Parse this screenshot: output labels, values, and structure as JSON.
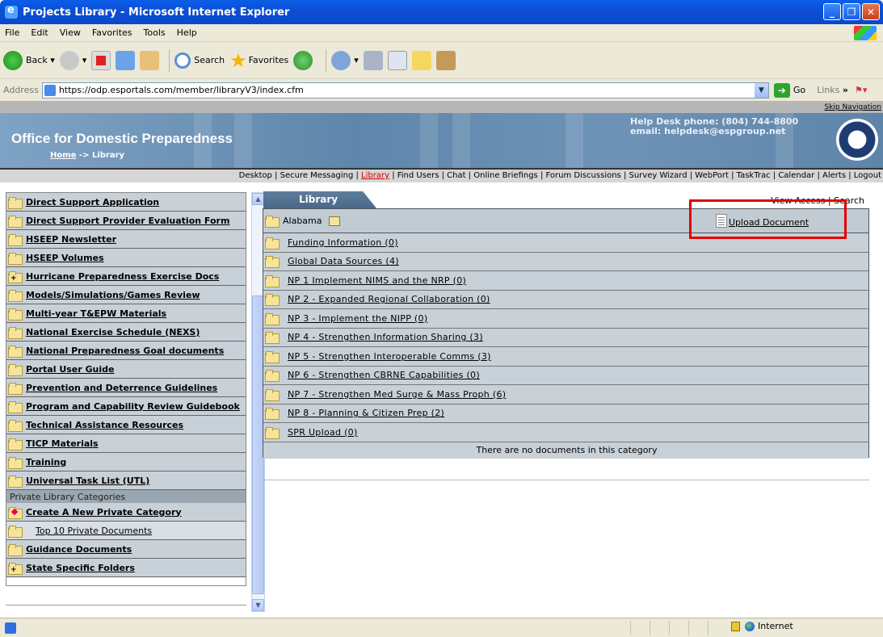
{
  "window": {
    "title": "Projects Library - Microsoft Internet Explorer"
  },
  "menu": [
    "File",
    "Edit",
    "View",
    "Favorites",
    "Tools",
    "Help"
  ],
  "toolbar": {
    "back": "Back",
    "search": "Search",
    "favorites": "Favorites"
  },
  "address": {
    "label": "Address",
    "url": "https://odp.esportals.com/member/libraryV3/index.cfm",
    "go": "Go",
    "links": "Links"
  },
  "skip_nav": "Skip Navigation",
  "header": {
    "org": "Office for Domestic Preparedness",
    "crumb_home": "Home",
    "crumb_rest": " -> Library",
    "help_phone": "Help Desk phone: (804) 744-8800",
    "help_email": "email: helpdesk@espgroup.net"
  },
  "nav": {
    "before": "Desktop | Secure Messaging | ",
    "selected": "Library",
    "after": " | Find Users | Chat | Online Briefings | Forum Discussions | Survey Wizard | WebPort | TaskTrac | Calendar | Alerts | Logout"
  },
  "sidebar": {
    "items": [
      {
        "label": "Direct Support Application",
        "plus": false
      },
      {
        "label": "Direct Support Provider Evaluation Form",
        "plus": false
      },
      {
        "label": "HSEEP Newsletter",
        "plus": false
      },
      {
        "label": "HSEEP Volumes",
        "plus": false
      },
      {
        "label": "Hurricane Preparedness Exercise Docs",
        "plus": true
      },
      {
        "label": "Models/Simulations/Games Review",
        "plus": false
      },
      {
        "label": "Multi-year T&EPW Materials",
        "plus": false
      },
      {
        "label": "National Exercise Schedule (NEXS)",
        "plus": false
      },
      {
        "label": "National Preparedness Goal documents",
        "plus": false
      },
      {
        "label": "Portal User Guide",
        "plus": false
      },
      {
        "label": "Prevention and Deterrence Guidelines",
        "plus": false
      },
      {
        "label": "Program and Capability Review Guidebook",
        "plus": false
      },
      {
        "label": "Technical Assistance Resources",
        "plus": false
      },
      {
        "label": "TICP Materials",
        "plus": false
      },
      {
        "label": "Training",
        "plus": false
      },
      {
        "label": "Universal Task List (UTL)",
        "plus": false
      }
    ],
    "private_header": "Private Library Categories",
    "create": "Create A New Private Category",
    "top10": "Top 10 Private Documents",
    "guidance": "Guidance Documents",
    "state": "State Specific Folders"
  },
  "library": {
    "tab": "Library",
    "view_access": "View Access",
    "search": "Search",
    "current_folder": "Alabama",
    "upload": "Upload Document",
    "folders": [
      "Funding Information (0)",
      "Global Data Sources (4)",
      "NP 1 Implement NIMS and the NRP (0)",
      "NP 2 - Expanded Regional Collaboration (0)",
      "NP 3 - Implement the NIPP (0)",
      "NP 4 - Strengthen Information Sharing (3)",
      "NP 5 - Strengthen Interoperable Comms (3)",
      "NP 6 - Strengthen CBRNE Capabilities (0)",
      "NP 7 - Strengthen Med Surge & Mass Proph (6)",
      "NP 8 - Planning & Citizen Prep (2)",
      "SPR Upload (0)"
    ],
    "empty_note": "There are no documents in this category"
  },
  "status": {
    "zone": "Internet"
  }
}
